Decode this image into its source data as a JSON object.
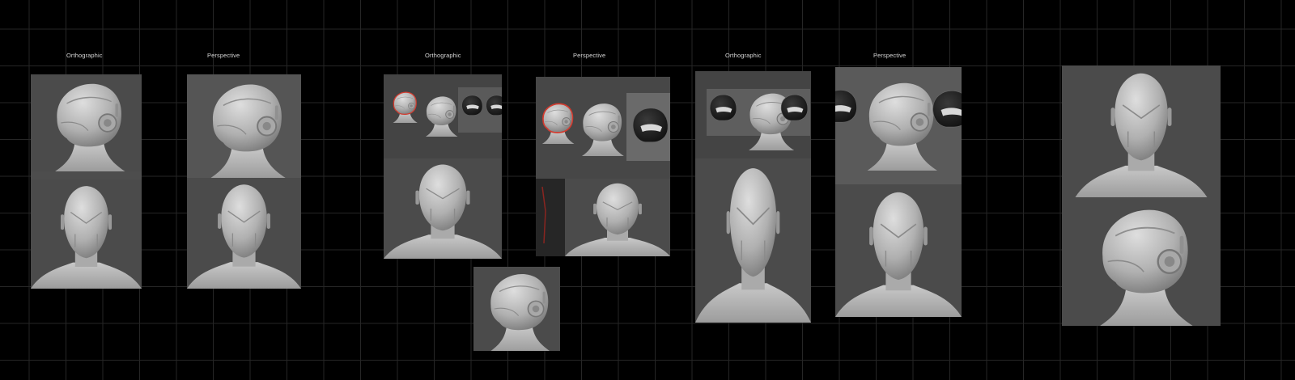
{
  "board": {
    "labels": [
      "Orthographic",
      "Perspective",
      "Orthographic",
      "Perspective",
      "Orthographic",
      "Perspective"
    ]
  },
  "colors": {
    "background": "#000000",
    "grid": "#262626",
    "panel": "#4d4d4d",
    "model": "#b4b4b4",
    "highlight": "#d23b2f"
  }
}
